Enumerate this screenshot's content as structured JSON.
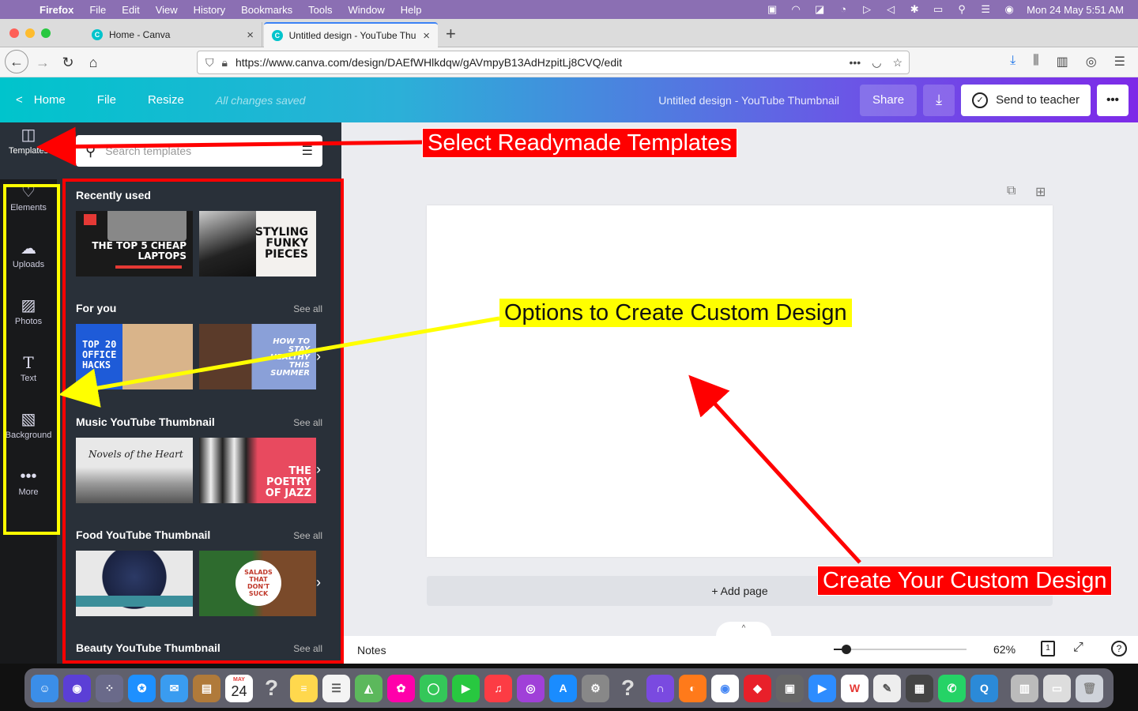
{
  "menubar": {
    "app": "Firefox",
    "items": [
      "File",
      "Edit",
      "View",
      "History",
      "Bookmarks",
      "Tools",
      "Window",
      "Help"
    ],
    "datetime": "Mon 24 May  5:51 AM"
  },
  "tabs": [
    {
      "label": "Home - Canva"
    },
    {
      "label": "Untitled design - YouTube Thum"
    }
  ],
  "url": "https://www.canva.com/design/DAEfWHlkdqw/gAVmpyB13AdHzpitLj8CVQ/edit",
  "canva_header": {
    "home": "Home",
    "file": "File",
    "resize": "Resize",
    "saved": "All changes saved",
    "doc_title": "Untitled design - YouTube Thumbnail",
    "share": "Share",
    "send": "Send to teacher",
    "more": "•••"
  },
  "rail": [
    {
      "label": "Templates",
      "icon": "templates-icon"
    },
    {
      "label": "Elements",
      "icon": "elements-icon"
    },
    {
      "label": "Uploads",
      "icon": "upload-cloud-icon"
    },
    {
      "label": "Photos",
      "icon": "image-icon"
    },
    {
      "label": "Text",
      "icon": "text-icon"
    },
    {
      "label": "Background",
      "icon": "background-icon"
    },
    {
      "label": "More",
      "icon": "more-dots-icon"
    }
  ],
  "panel": {
    "search_placeholder": "Search templates",
    "see_all": "See all",
    "sections": [
      {
        "title": "Recently used",
        "thumbs": [
          "THE TOP 5 CHEAP LAPTOPS",
          "STYLING FUNKY PIECES"
        ]
      },
      {
        "title": "For you",
        "thumbs": [
          "TOP 20 OFFICE HACKS",
          "HOW TO STAY HEALTHY THIS SUMMER"
        ]
      },
      {
        "title": "Music YouTube Thumbnail",
        "thumbs": [
          "Novels of the Heart",
          "THE POETRY OF JAZZ"
        ]
      },
      {
        "title": "Food YouTube Thumbnail",
        "thumbs": [
          "",
          "SALADS THAT DON'T SUCK"
        ]
      },
      {
        "title": "Beauty YouTube Thumbnail",
        "thumbs": []
      }
    ]
  },
  "canvas": {
    "add_page": "+ Add page",
    "notes": "Notes",
    "zoom": "62%",
    "page_count": "1",
    "help": "?"
  },
  "annotations": {
    "templates": "Select Readymade Templates",
    "options": "Options to Create Custom Design",
    "create": "Create Your Custom Design"
  },
  "dock": {
    "calendar_month": "MAY",
    "calendar_day": "24"
  },
  "colors": {
    "red": "#ff0000",
    "yellow": "#ffff00",
    "canva_teal": "#00c4cc",
    "canva_purple": "#7d2ae8"
  }
}
